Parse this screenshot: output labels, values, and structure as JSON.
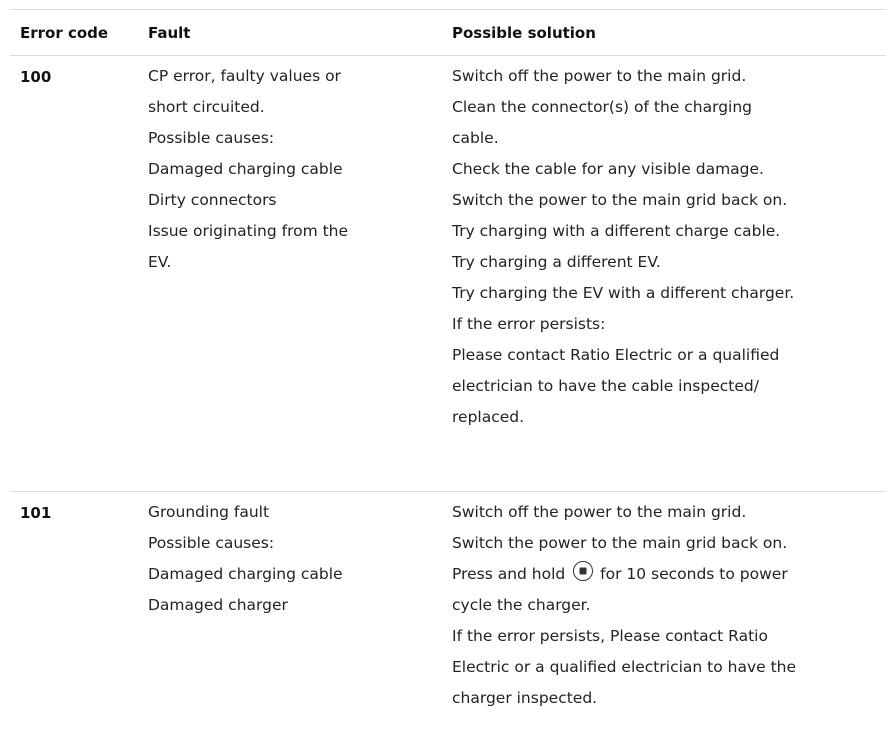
{
  "header": {
    "col1": "Error code",
    "col2": "Fault",
    "col3": "Possible solution"
  },
  "rows": [
    {
      "code": "100",
      "fault_lines": [
        "CP error, faulty values or",
        "short circuited.",
        "Possible causes:",
        "Damaged charging cable",
        "Dirty connectors",
        "Issue originating from the",
        "EV."
      ],
      "solution_lines": [
        "Switch off the power to the main grid.",
        "Clean the connector(s) of the charging",
        "cable.",
        "Check the cable for any visible damage.",
        "Switch the power to the main grid back on.",
        "Try charging with a different charge cable.",
        "Try charging a different EV.",
        "Try charging the EV with a different charger.",
        "If the error persists:",
        "Please contact Ratio Electric or a qualified",
        "electrician to have the cable inspected/",
        "replaced."
      ]
    },
    {
      "code": "101",
      "fault_lines": [
        "Grounding fault",
        "Possible causes:",
        "Damaged charging cable",
        "Damaged charger"
      ],
      "solution_lines": [
        "Switch off the power to the main grid.",
        "Switch the power to the main grid back on.",
        "Press and hold",
        "for 10 seconds to power",
        "cycle the charger.",
        "If the error persists, Please contact Ratio",
        "Electric or a qualified electrician to have the",
        "charger inspected."
      ]
    }
  ],
  "icons": {
    "power_button": "power-button-icon"
  }
}
